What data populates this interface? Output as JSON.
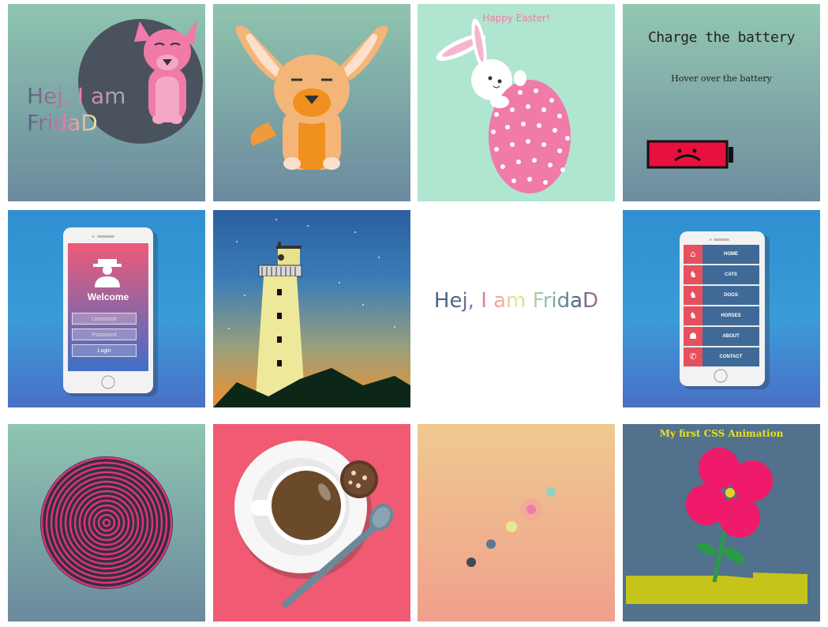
{
  "tiles": {
    "fridad_dog": {
      "line1": "Hej, I am",
      "line2": "FridaD"
    },
    "easter": {
      "title": "Happy Easter!"
    },
    "battery": {
      "title": "Charge the battery",
      "hint": "Hover over the battery"
    },
    "login": {
      "title": "Welcome",
      "username_placeholder": "Username",
      "password_placeholder": "Password",
      "login_label": "Login"
    },
    "logo": {
      "text": "Hej, I am FridaD"
    },
    "menu": {
      "items": [
        {
          "label": "HOME",
          "icon": "home-icon"
        },
        {
          "label": "CATS",
          "icon": "cat-icon"
        },
        {
          "label": "DOGS",
          "icon": "dog-icon"
        },
        {
          "label": "HORSES",
          "icon": "horse-icon"
        },
        {
          "label": "ABOUT",
          "icon": "about-icon"
        },
        {
          "label": "CONTACT",
          "icon": "phone-icon"
        }
      ]
    },
    "flower": {
      "title": "My first CSS Animation"
    }
  },
  "colors": {
    "pink": "#f07aa8",
    "coral": "#f05a72",
    "teal": "#b0e5d0"
  }
}
